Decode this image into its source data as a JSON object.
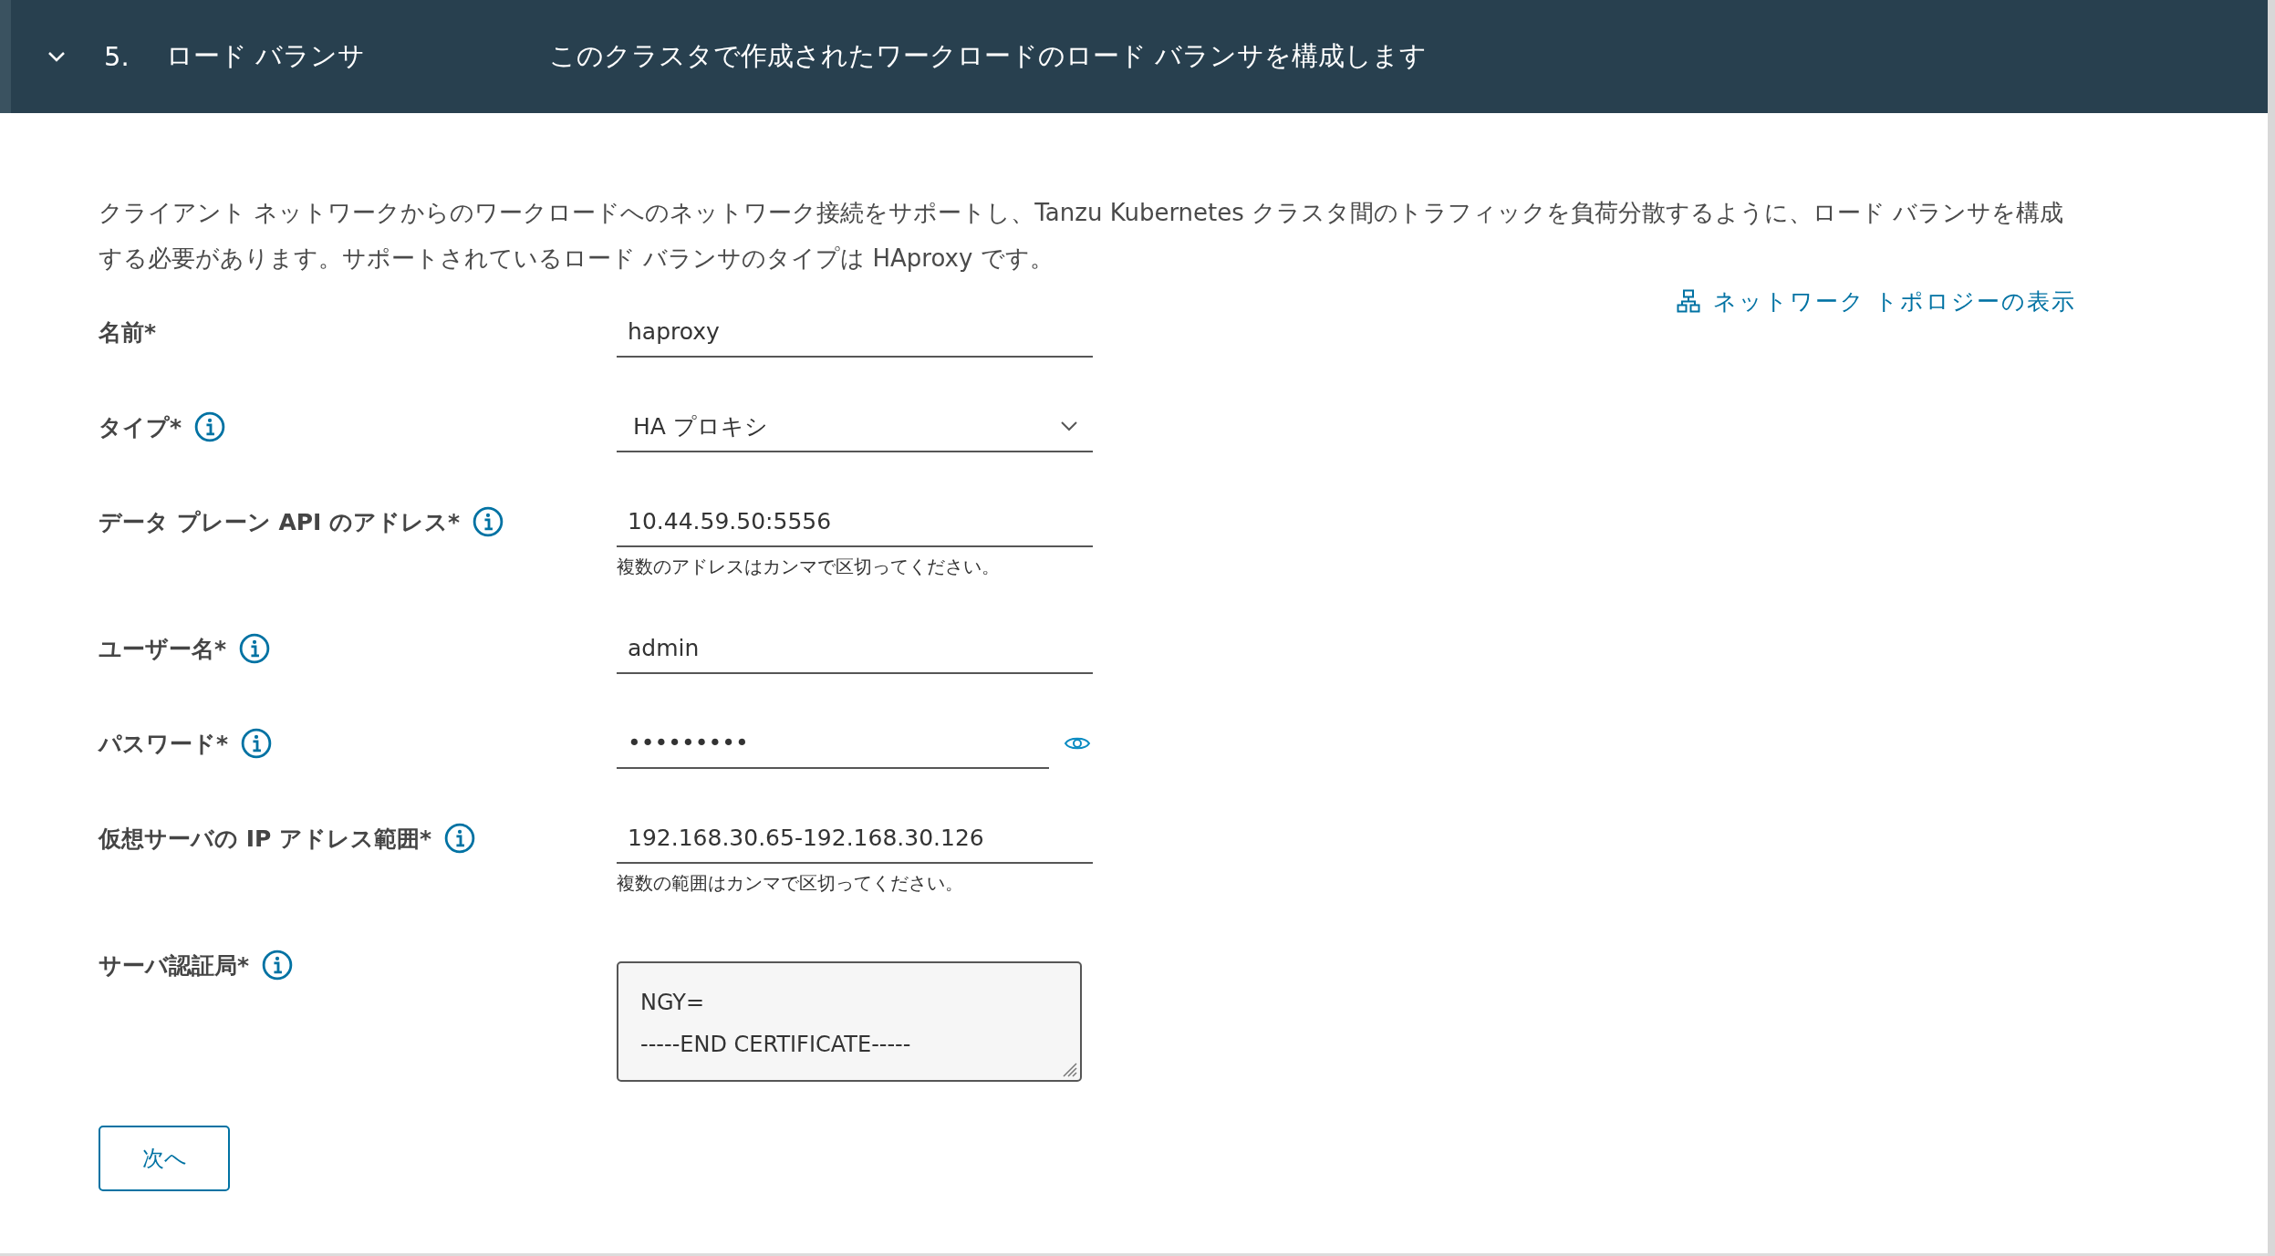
{
  "step": {
    "expanded": true,
    "number": "5.",
    "title": "ロード バランサ",
    "summary": "このクラスタで作成されたワークロードのロード バランサを構成します"
  },
  "description": "クライアント ネットワークからのワークロードへのネットワーク接続をサポートし、Tanzu Kubernetes クラスタ間のトラフィックを負荷分散するように、ロード バランサを構成する必要があります。サポートされているロード バランサのタイプは HAproxy です。",
  "topology_link": "ネットワーク トポロジーの表示",
  "fields": [
    {
      "kind": "text",
      "label": "名前*",
      "info": false,
      "value": "haproxy"
    },
    {
      "kind": "select",
      "label": "タイプ*",
      "info": true,
      "value": "HA プロキシ"
    },
    {
      "kind": "text",
      "label": "データ プレーン API のアドレス*",
      "info": true,
      "value": "10.44.59.50:5556",
      "helper": "複数のアドレスはカンマで区切ってください。"
    },
    {
      "kind": "text",
      "label": "ユーザー名*",
      "info": true,
      "value": "admin"
    },
    {
      "kind": "password",
      "label": "パスワード*",
      "info": true,
      "value": "•••••••••"
    },
    {
      "kind": "text",
      "label": "仮想サーバの IP アドレス範囲*",
      "info": true,
      "value": "192.168.30.65-192.168.30.126",
      "helper": "複数の範囲はカンマで区切ってください。"
    },
    {
      "kind": "textarea",
      "label": "サーバ認証局*",
      "info": true,
      "value": "NGY=\n-----END CERTIFICATE-----"
    }
  ],
  "next_button": "次へ"
}
